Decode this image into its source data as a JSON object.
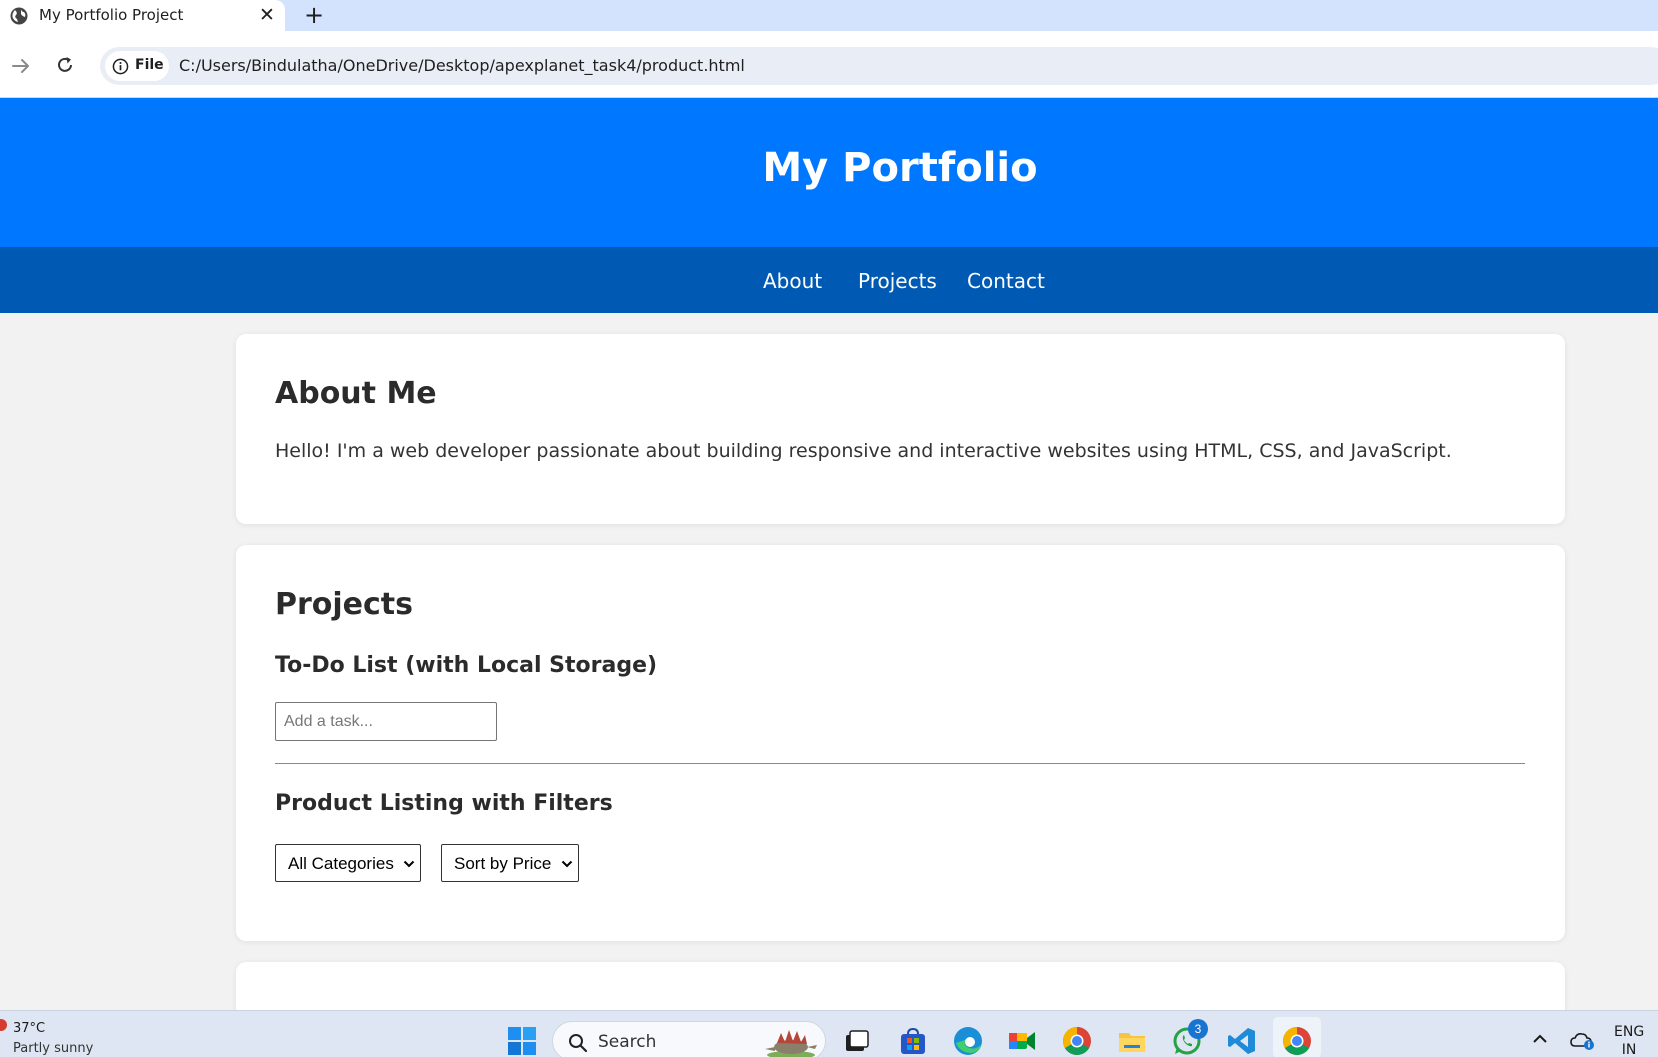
{
  "browser": {
    "tab_title": "My Portfolio Project",
    "close_glyph": "✕",
    "new_tab_glyph": "+",
    "site_info_label": "File",
    "url": "C:/Users/Bindulatha/OneDrive/Desktop/apexplanet_task4/product.html"
  },
  "site": {
    "title": "My Portfolio",
    "nav": [
      "About",
      "Projects",
      "Contact"
    ]
  },
  "about": {
    "heading": "About Me",
    "text": "Hello! I'm a web developer passionate about building responsive and interactive websites using HTML, CSS, and JavaScript."
  },
  "projects": {
    "heading": "Projects",
    "todo_heading": "To-Do List (with Local Storage)",
    "todo_placeholder": "Add a task...",
    "product_heading": "Product Listing with Filters",
    "category_select": "All Categories",
    "sort_select": "Sort by Price"
  },
  "taskbar": {
    "temperature": "37°C",
    "weather": "Partly sunny",
    "search_label": "Search",
    "whatsapp_badge": "3",
    "lang_line1": "ENG",
    "lang_line2": "IN",
    "apps": [
      "task-view-icon",
      "microsoft-store-icon",
      "edge-icon",
      "google-meet-icon",
      "chrome-icon",
      "file-explorer-icon",
      "whatsapp-icon",
      "vscode-icon",
      "chrome-icon"
    ]
  },
  "colors": {
    "header_blue": "#0077ff",
    "nav_blue": "#0059b3",
    "page_bg": "#f2f2f2"
  }
}
